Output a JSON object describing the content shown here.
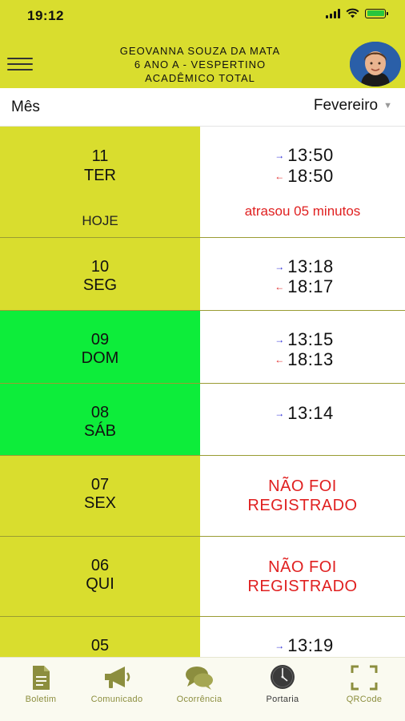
{
  "status_bar": {
    "time": "19:12"
  },
  "header": {
    "student_name": "GEOVANNA SOUZA DA MATA",
    "class_info": "6 ANO A - VESPERTINO",
    "school": "ACADÊMICO TOTAL"
  },
  "month_filter": {
    "label": "Mês",
    "selected": "Fevereiro"
  },
  "colors": {
    "header_bg": "#d9dd2e",
    "weekday_bg": "#d9dd2e",
    "weekend_bg": "#0ded3a",
    "entry_arrow": "#2a2ad6",
    "exit_arrow": "#e02020",
    "alert_text": "#e02020"
  },
  "records": [
    {
      "day": "11",
      "weekday": "TER",
      "today_label": "HOJE",
      "entry_arrow": "→",
      "entry": "13:50",
      "exit_arrow": "←",
      "exit": "18:50",
      "note": "atrasou 05 minutos",
      "weekend": false
    },
    {
      "day": "10",
      "weekday": "SEG",
      "entry_arrow": "→",
      "entry": "13:18",
      "exit_arrow": "←",
      "exit": "18:17",
      "weekend": false
    },
    {
      "day": "09",
      "weekday": "DOM",
      "entry_arrow": "→",
      "entry": "13:15",
      "exit_arrow": "←",
      "exit": "18:13",
      "weekend": true
    },
    {
      "day": "08",
      "weekday": "SÁB",
      "entry_arrow": "→",
      "entry": "13:14",
      "weekend": true
    },
    {
      "day": "07",
      "weekday": "SEX",
      "status_line1": "NÃO FOI",
      "status_line2": "REGISTRADO",
      "weekend": false
    },
    {
      "day": "06",
      "weekday": "QUI",
      "status_line1": "NÃO FOI",
      "status_line2": "REGISTRADO",
      "weekend": false
    },
    {
      "day": "05",
      "weekday": "",
      "entry_arrow": "→",
      "entry": "13:19",
      "weekend": false
    }
  ],
  "tabs": [
    {
      "label": "Boletim",
      "icon": "document-icon"
    },
    {
      "label": "Comunicado",
      "icon": "megaphone-icon"
    },
    {
      "label": "Ocorrência",
      "icon": "chat-bubbles-icon"
    },
    {
      "label": "Portaria",
      "icon": "clock-icon",
      "active": true
    },
    {
      "label": "QRCode",
      "icon": "qrcode-scan-icon"
    }
  ]
}
